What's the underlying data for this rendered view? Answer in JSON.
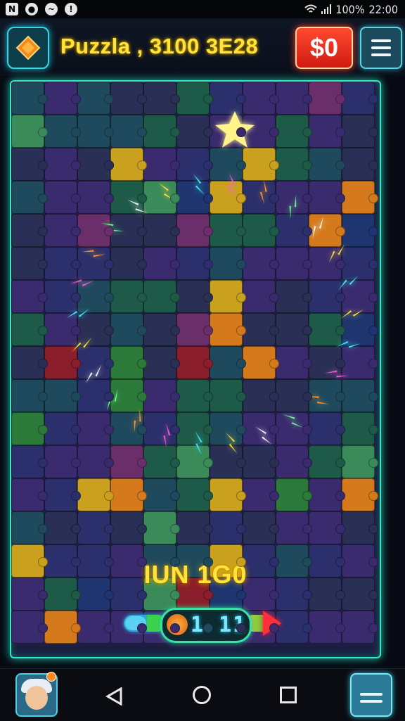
{
  "status_bar": {
    "left_icons": [
      "notification-icon",
      "messenger-icon",
      "chat-icon",
      "alert-icon"
    ],
    "battery": "100%",
    "time": "22:00"
  },
  "header": {
    "title": "Puzzla , 3100 3E28",
    "coin_label": "$0",
    "gem_icon": "diamond-gem-icon",
    "menu_icon": "hamburger-menu-icon"
  },
  "board": {
    "banner_text": "IUN 1G0",
    "counter_text": "1 11",
    "tile_colors": [
      "#2b2f6b",
      "#3a2a6e",
      "#1f4a5e",
      "#1e5a48",
      "#2a2f55",
      "#6a2e6a",
      "#2b7a3a",
      "#c9a11e",
      "#d47a1c",
      "#8a1e2a",
      "#1e3570",
      "#3b8a5a"
    ],
    "accent": "#38e6c8"
  },
  "nav": {
    "back_icon": "back-triangle-icon",
    "home_icon": "home-circle-icon",
    "recent_icon": "recent-square-icon",
    "avatar_icon": "player-avatar-icon",
    "inbox_icon": "inbox-icon"
  }
}
